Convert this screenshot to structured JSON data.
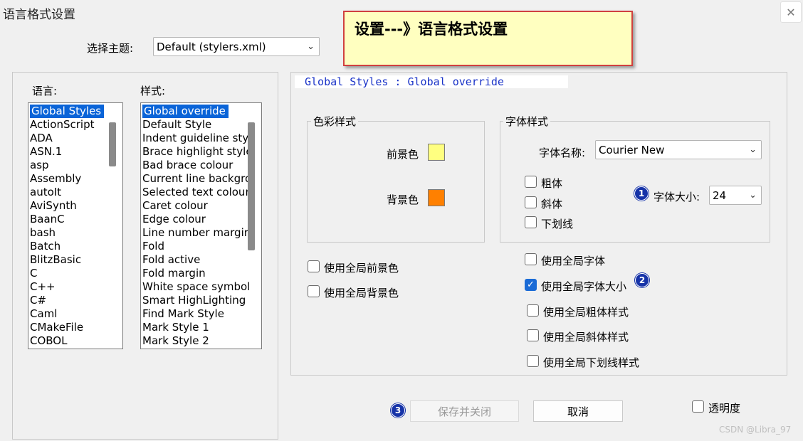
{
  "window": {
    "title": "语言格式设置",
    "close_label": "✕"
  },
  "callout": {
    "text": "设置---》语言格式设置"
  },
  "theme": {
    "label": "选择主题:",
    "value": "Default (stylers.xml)"
  },
  "languages": {
    "label": "语言:",
    "items": [
      "Global Styles",
      "ActionScript",
      "ADA",
      "ASN.1",
      "asp",
      "Assembly",
      "autoIt",
      "AviSynth",
      "BaanC",
      "bash",
      "Batch",
      "BlitzBasic",
      "C",
      "C++",
      "C#",
      "Caml",
      "CMakeFile",
      "COBOL"
    ],
    "selected_index": 0
  },
  "styles": {
    "label": "样式:",
    "items": [
      "Global override",
      "Default Style",
      "Indent guideline sty",
      "Brace highlight style",
      "Bad brace colour",
      "Current line backgro",
      "Selected text colour",
      "Caret colour",
      "Edge colour",
      "Line number margir",
      "Fold",
      "Fold active",
      "Fold margin",
      "White space symbol",
      "Smart HighLighting",
      "Find Mark Style",
      "Mark Style 1",
      "Mark Style 2"
    ],
    "selected_index": 0
  },
  "style_header": "Global Styles : Global override",
  "color_group": {
    "title": "色彩样式",
    "fg_label": "前景色",
    "fg_color": "#ffff80",
    "bg_label": "背景色",
    "bg_color": "#ff8000"
  },
  "font_group": {
    "title": "字体样式",
    "font_name_label": "字体名称:",
    "font_name_value": "Courier New",
    "bold_label": "粗体",
    "italic_label": "斜体",
    "underline_label": "下划线",
    "font_size_label": "字体大小:",
    "font_size_value": "24"
  },
  "global_options": {
    "use_global_fg": "使用全局前景色",
    "use_global_bg": "使用全局背景色",
    "use_global_font": "使用全局字体",
    "use_global_font_size": "使用全局字体大小",
    "use_global_bold": "使用全局粗体样式",
    "use_global_italic": "使用全局斜体样式",
    "use_global_underline": "使用全局下划线样式"
  },
  "badges": [
    "1",
    "2",
    "3"
  ],
  "buttons": {
    "save_close": "保存并关闭",
    "cancel": "取消",
    "transparency": "透明度"
  },
  "watermark": "CSDN @Libra_97"
}
